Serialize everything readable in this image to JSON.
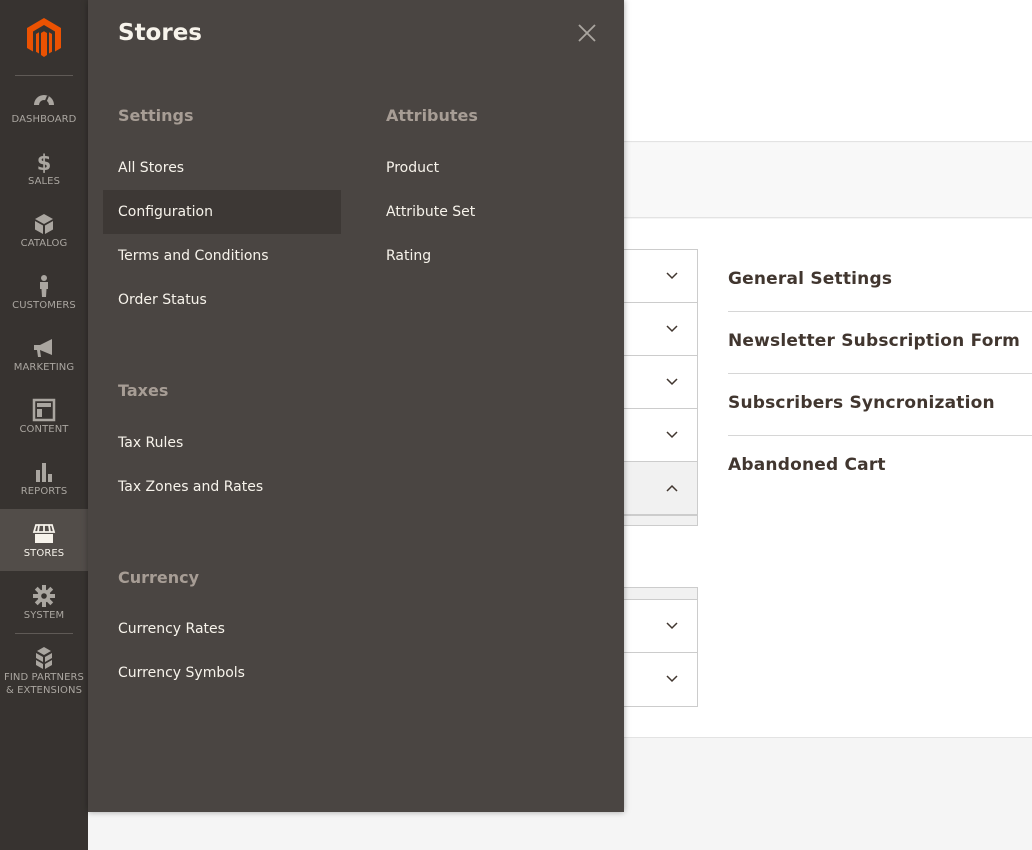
{
  "rail": {
    "items": [
      {
        "label": "DASHBOARD",
        "icon": "dashboard-icon"
      },
      {
        "label": "SALES",
        "icon": "dollar-icon"
      },
      {
        "label": "CATALOG",
        "icon": "cube-icon"
      },
      {
        "label": "CUSTOMERS",
        "icon": "person-icon"
      },
      {
        "label": "MARKETING",
        "icon": "megaphone-icon"
      },
      {
        "label": "CONTENT",
        "icon": "layout-icon"
      },
      {
        "label": "REPORTS",
        "icon": "bar-chart-icon"
      },
      {
        "label": "STORES",
        "icon": "storefront-icon",
        "active": true
      },
      {
        "label": "SYSTEM",
        "icon": "gear-icon"
      },
      {
        "label": "FIND PARTNERS",
        "label2": "& EXTENSIONS",
        "icon": "boxes-icon"
      }
    ]
  },
  "flyout": {
    "title": "Stores",
    "settings": {
      "title": "Settings",
      "items": [
        "All Stores",
        "Configuration",
        "Terms and Conditions",
        "Order Status"
      ],
      "active_index": 1
    },
    "taxes": {
      "title": "Taxes",
      "items": [
        "Tax Rules",
        "Tax Zones and Rates"
      ]
    },
    "currency": {
      "title": "Currency",
      "items": [
        "Currency Rates",
        "Currency Symbols"
      ]
    },
    "attributes": {
      "title": "Attributes",
      "items": [
        "Product",
        "Attribute Set",
        "Rating"
      ]
    }
  },
  "sections": {
    "items": [
      "General Settings",
      "Newsletter Subscription Form",
      "Subscribers Syncronization",
      "Abandoned Cart"
    ]
  },
  "colors": {
    "rail_bg": "#373330",
    "flyout_bg": "#4a4542",
    "accent_logo": "#eb5202",
    "active_item_bg": "#3d3835"
  }
}
